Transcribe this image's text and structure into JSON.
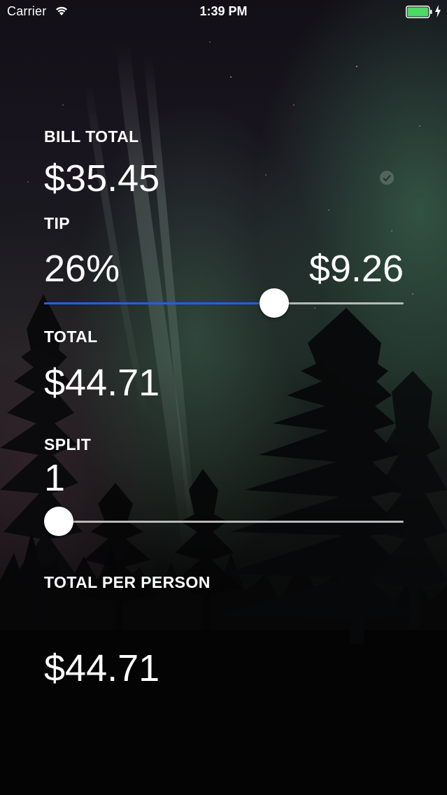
{
  "status_bar": {
    "carrier": "Carrier",
    "time": "1:39 PM",
    "battery_color": "#4cd964",
    "icons": [
      "wifi-icon",
      "battery-icon",
      "charging-bolt-icon"
    ]
  },
  "bill_total": {
    "label": "BILL TOTAL",
    "value": "$35.45"
  },
  "tip": {
    "label": "TIP",
    "percent": "26%",
    "amount": "$9.26",
    "slider_fraction": 0.64,
    "slider_fill_color": "#1a63e6"
  },
  "total": {
    "label": "TOTAL",
    "value": "$44.71"
  },
  "split": {
    "label": "SPLIT",
    "value": "1",
    "slider_fraction": 0.04
  },
  "total_per_person": {
    "label": "TOTAL PER PERSON",
    "value": "$44.71"
  },
  "decorations": {
    "background": "northern-lights-forest",
    "faint_icon": "checkmark-circle-icon"
  }
}
